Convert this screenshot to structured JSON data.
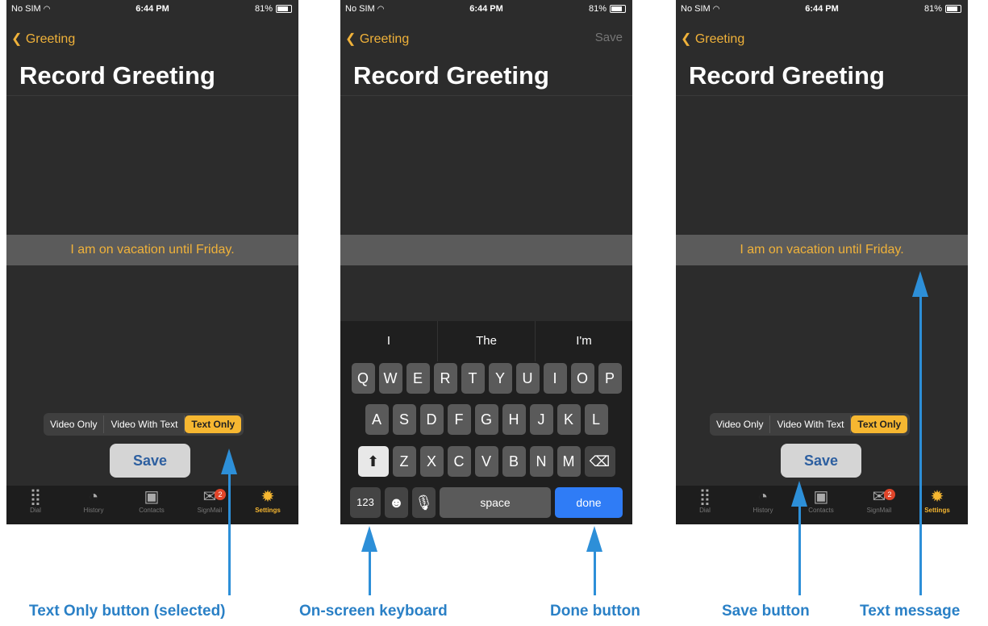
{
  "status": {
    "carrier": "No SIM",
    "time": "6:44 PM",
    "battery": "81%"
  },
  "nav": {
    "back_label": "Greeting",
    "save_label": "Save"
  },
  "page_title": "Record Greeting",
  "message_text": "I am on vacation until Friday.",
  "segments": [
    "Video Only",
    "Video With Text",
    "Text Only"
  ],
  "save_button_label": "Save",
  "tabs": [
    {
      "label": "Dial",
      "icon": "dial-grid-icon"
    },
    {
      "label": "History",
      "icon": "clock-icon"
    },
    {
      "label": "Contacts",
      "icon": "contacts-book-icon"
    },
    {
      "label": "SignMail",
      "icon": "envelope-icon",
      "badge": "2"
    },
    {
      "label": "Settings",
      "icon": "gear-icon"
    }
  ],
  "keyboard": {
    "suggestions": [
      "I",
      "The",
      "I'm"
    ],
    "row1": [
      "Q",
      "W",
      "E",
      "R",
      "T",
      "Y",
      "U",
      "I",
      "O",
      "P"
    ],
    "row2": [
      "A",
      "S",
      "D",
      "F",
      "G",
      "H",
      "J",
      "K",
      "L"
    ],
    "row3": [
      "Z",
      "X",
      "C",
      "V",
      "B",
      "N",
      "M"
    ],
    "numbers_key": "123",
    "space_key": "space",
    "done_key": "done"
  },
  "callouts": {
    "text_only": "Text Only button (selected)",
    "keyboard": "On-screen keyboard",
    "done": "Done button",
    "save": "Save button",
    "text_message": "Text message"
  },
  "colors": {
    "accent": "#f6b731",
    "callout_blue": "#2d8fd8",
    "done_key": "#2f7cf6"
  }
}
